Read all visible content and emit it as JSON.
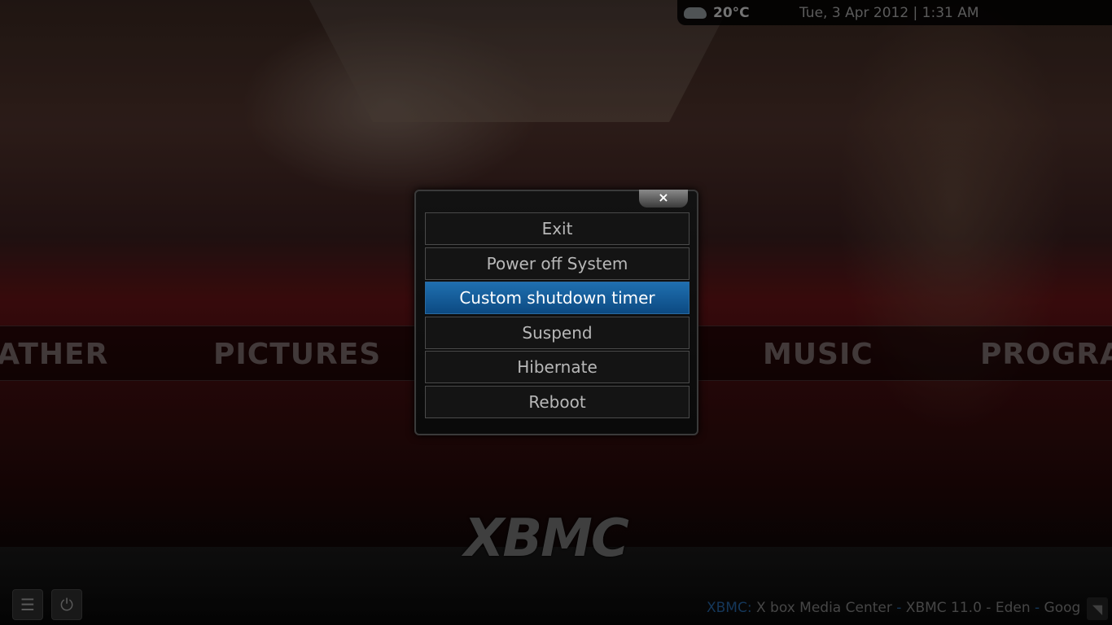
{
  "header": {
    "weather_icon": "cloud-icon",
    "temperature": "20°C",
    "datetime": "Tue, 3 Apr 2012 | 1:31 AM"
  },
  "home_menu": {
    "items": [
      "WEATHER",
      "PICTURES",
      "MUSIC",
      "PROGRAMS"
    ]
  },
  "dialog": {
    "close_label": "×",
    "options": [
      {
        "label": "Exit",
        "selected": false
      },
      {
        "label": "Power off System",
        "selected": false
      },
      {
        "label": "Custom shutdown timer",
        "selected": true
      },
      {
        "label": "Suspend",
        "selected": false
      },
      {
        "label": "Hibernate",
        "selected": false
      },
      {
        "label": "Reboot",
        "selected": false
      }
    ],
    "accent": "#1565a8"
  },
  "logo": "XBMC",
  "footer": {
    "brand": "XBMC:",
    "t1": " X box Media Center ",
    "sep": "-",
    "t2": " XBMC 11.0 - Eden ",
    "t3": " Goog",
    "buttons": [
      "favourites-icon",
      "power-icon"
    ],
    "rss_icon": "rss-icon"
  }
}
